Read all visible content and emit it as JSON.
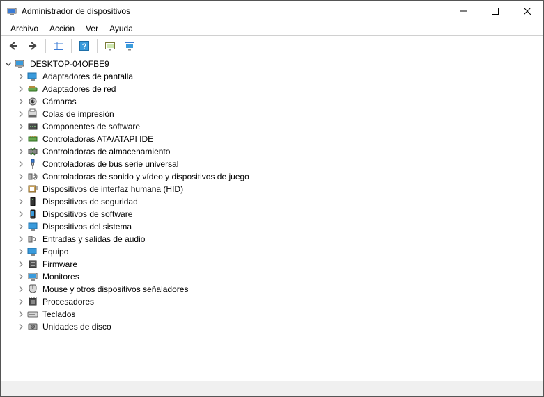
{
  "window": {
    "title": "Administrador de dispositivos"
  },
  "menu": {
    "file": "Archivo",
    "action": "Acción",
    "view": "Ver",
    "help": "Ayuda"
  },
  "tree": {
    "root": "DESKTOP-04OFBE9",
    "items": [
      "Adaptadores de pantalla",
      "Adaptadores de red",
      "Cámaras",
      "Colas de impresión",
      "Componentes de software",
      "Controladoras ATA/ATAPI IDE",
      "Controladoras de almacenamiento",
      "Controladoras de bus serie universal",
      "Controladoras de sonido y vídeo y dispositivos de juego",
      "Dispositivos de interfaz humana (HID)",
      "Dispositivos de seguridad",
      "Dispositivos de software",
      "Dispositivos del sistema",
      "Entradas y salidas de audio",
      "Equipo",
      "Firmware",
      "Monitores",
      "Mouse y otros dispositivos señaladores",
      "Procesadores",
      "Teclados",
      "Unidades de disco"
    ]
  }
}
